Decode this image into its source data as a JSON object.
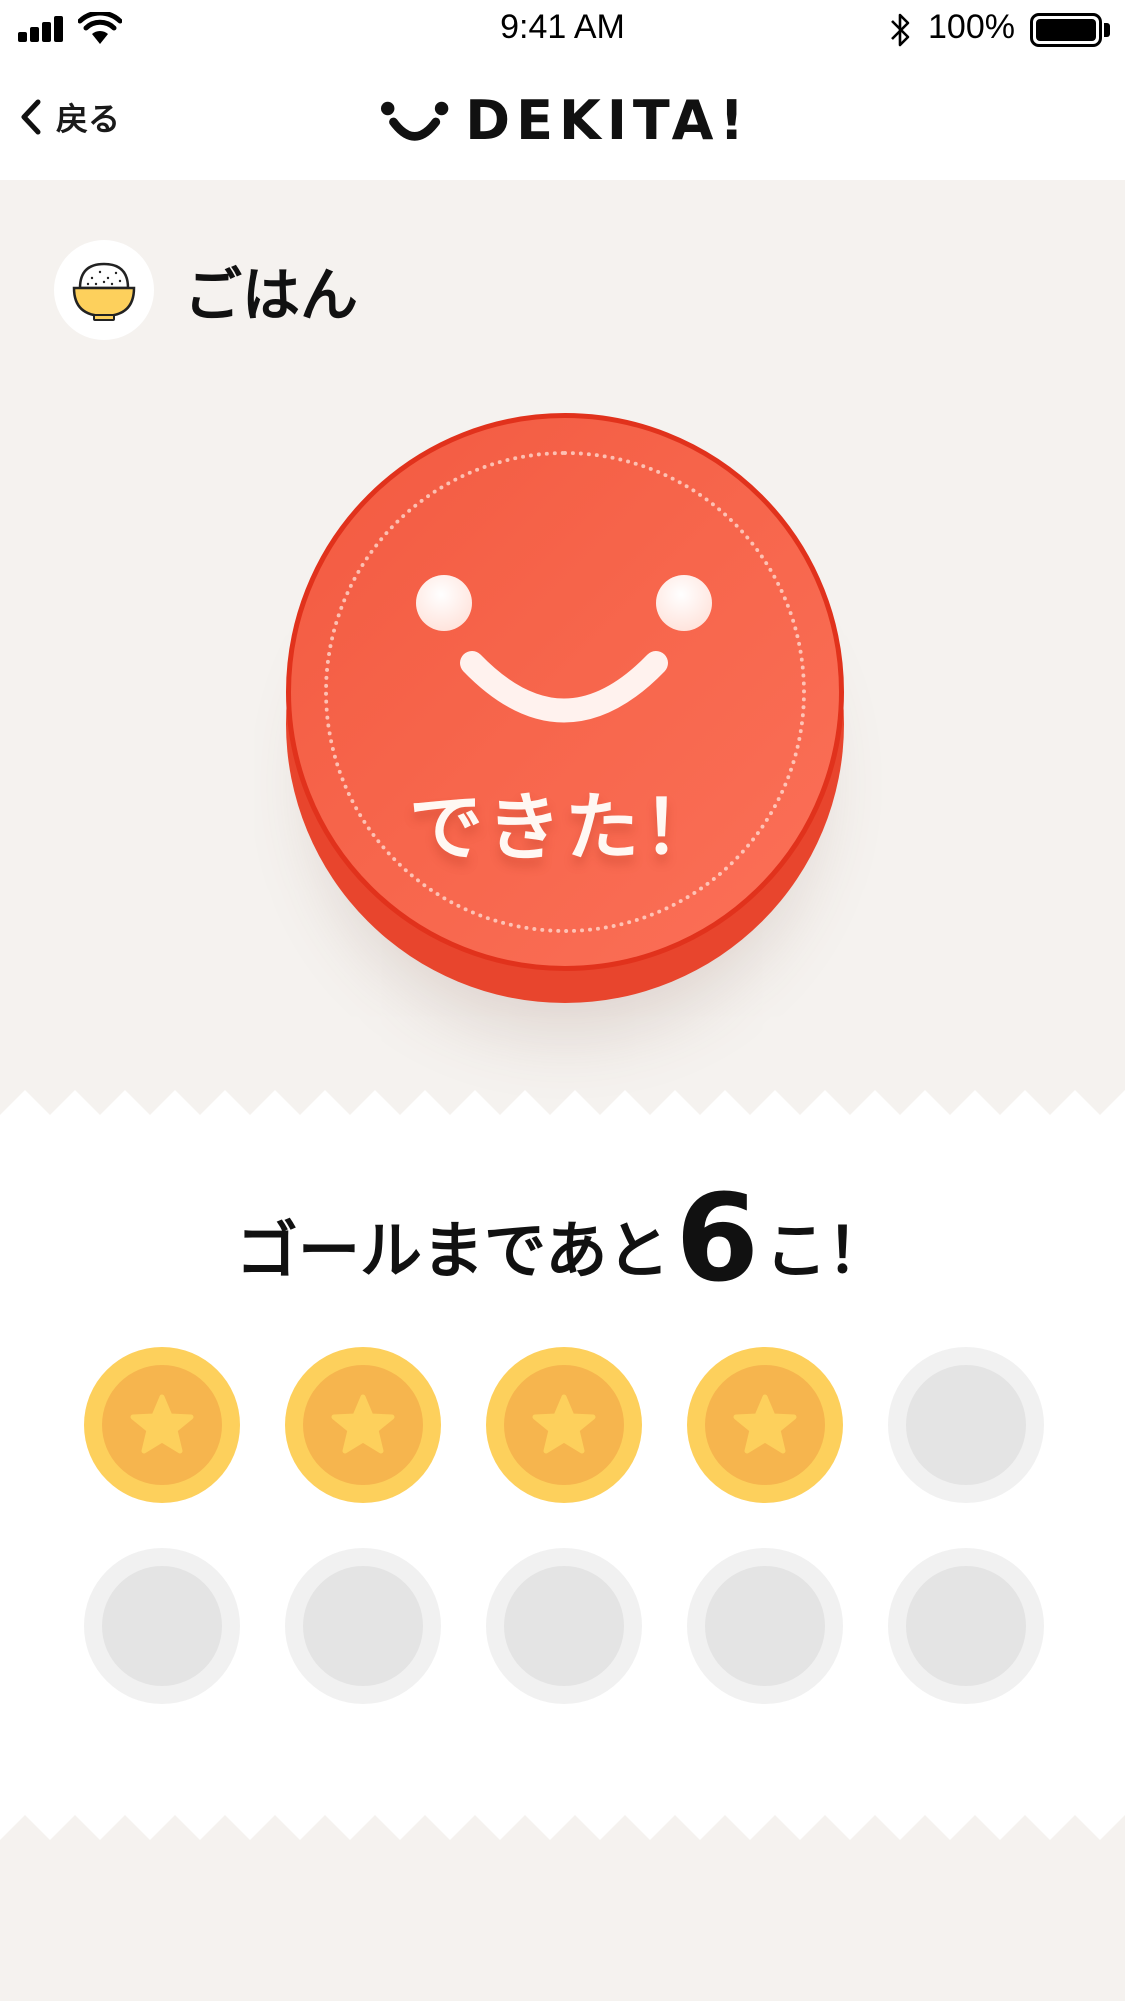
{
  "status_bar": {
    "time": "9:41 AM",
    "battery_percent": "100%",
    "signal_bars": 4,
    "icons": [
      "signal-icon",
      "wifi-icon",
      "bluetooth-icon",
      "battery-icon"
    ]
  },
  "nav": {
    "back_label": "戻る",
    "logo_text": "DEKITA!"
  },
  "task": {
    "name": "ごはん",
    "icon": "rice-bowl-icon"
  },
  "done_button": {
    "label": "できた！"
  },
  "goal": {
    "prefix": "ゴールまであと",
    "remaining": "6",
    "suffix": "こ！"
  },
  "stamps": {
    "total": 10,
    "collected": 4
  },
  "colors": {
    "button_red": "#f7664c",
    "coin_gold": "#fdd05c",
    "coin_gold_inner": "#f6b54e",
    "coin_empty": "#f1f1f1",
    "background": "#f5f2ef"
  }
}
